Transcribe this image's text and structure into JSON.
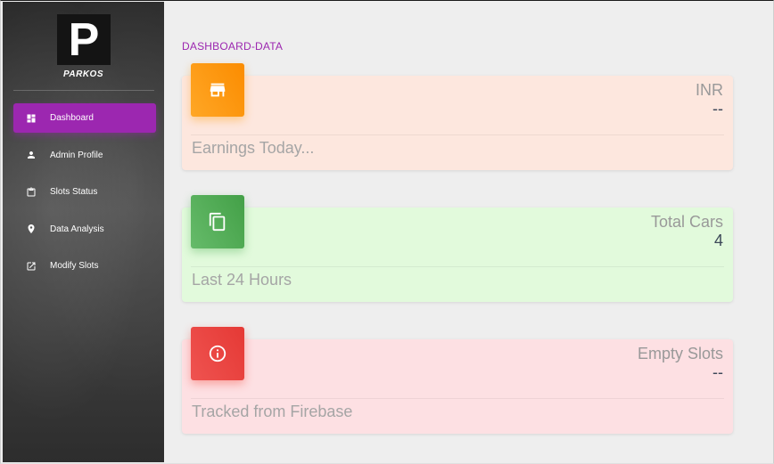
{
  "sidebar": {
    "logo_letter": "P",
    "brand": "PARKOS",
    "items": [
      {
        "label": "Dashboard",
        "icon": "dashboard-icon",
        "active": true
      },
      {
        "label": "Admin Profile",
        "icon": "person-icon",
        "active": false
      },
      {
        "label": "Slots Status",
        "icon": "clipboard-icon",
        "active": false
      },
      {
        "label": "Data Analysis",
        "icon": "location-pin-icon",
        "active": false
      },
      {
        "label": "Modify Slots",
        "icon": "edit-icon",
        "active": false
      }
    ]
  },
  "main": {
    "title": "DASHBOARD-DATA",
    "cards": [
      {
        "icon": "store-icon",
        "label": "INR",
        "value": "--",
        "footer": "Earnings Today..."
      },
      {
        "icon": "copy-icon",
        "label": "Total Cars",
        "value": "4",
        "footer": "Last 24 Hours"
      },
      {
        "icon": "info-icon",
        "label": "Empty Slots",
        "value": "--",
        "footer": "Tracked from Firebase"
      }
    ]
  },
  "colors": {
    "accent": "#9c27b0",
    "warning": "#fb8c00",
    "success": "#43a047",
    "danger": "#e53935"
  }
}
